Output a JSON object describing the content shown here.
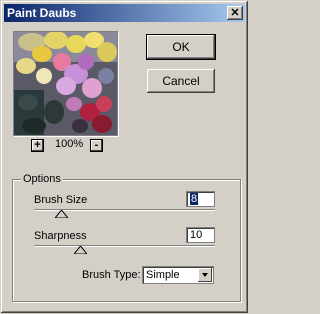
{
  "window": {
    "title": "Paint Daubs",
    "close_glyph": "✕"
  },
  "buttons": {
    "ok": "OK",
    "cancel": "Cancel"
  },
  "zoom": {
    "value": "100%",
    "in_glyph": "+",
    "out_glyph": "-"
  },
  "options": {
    "group_label": "Options",
    "brush_size": {
      "label": "Brush Size",
      "value": "8",
      "level": 0.16
    },
    "sharpness": {
      "label": "Sharpness",
      "value": "10",
      "level": 0.25
    },
    "brush_type": {
      "label": "Brush Type:",
      "selected": "Simple"
    }
  },
  "colors": {
    "title_start": "#0a246a",
    "title_end": "#a6caf0",
    "face": "#d4d0c8"
  }
}
